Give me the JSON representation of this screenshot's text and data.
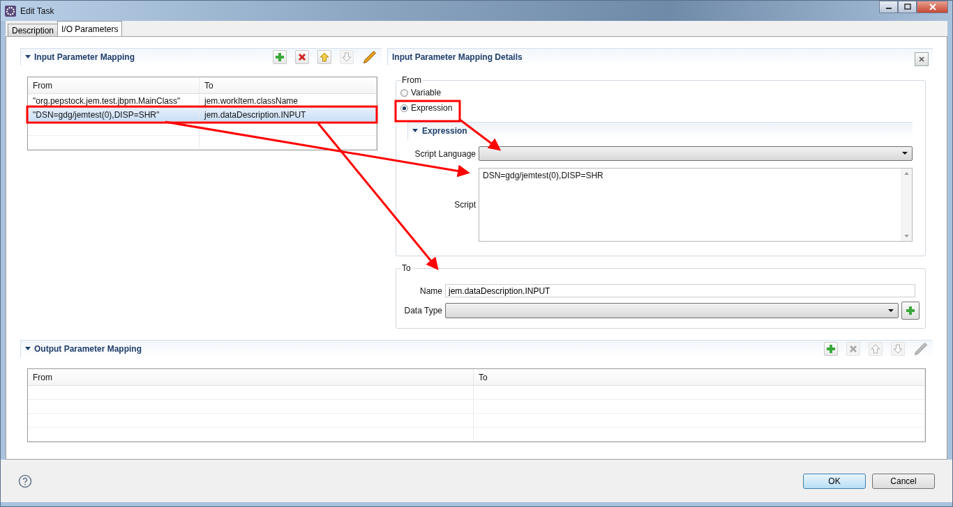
{
  "window": {
    "title": "Edit Task"
  },
  "tabs": [
    {
      "label": "Description",
      "selected": false
    },
    {
      "label": "I/O Parameters",
      "selected": true
    }
  ],
  "input_mapping": {
    "title": "Input Parameter Mapping",
    "toolbar": [
      {
        "kind": "add",
        "disabled": false
      },
      {
        "kind": "delete",
        "disabled": false
      },
      {
        "kind": "up",
        "disabled": false
      },
      {
        "kind": "down",
        "disabled": true
      },
      {
        "kind": "edit",
        "disabled": false
      }
    ],
    "columns": [
      "From",
      "To"
    ],
    "rows": [
      {
        "from": "\"org.pepstock.jem.test.jbpm.MainClass\"",
        "to": "jem.workItem.className",
        "selected": false
      },
      {
        "from": "\"DSN=gdg/jemtest(0),DISP=SHR\"",
        "to": "jem.dataDescription.INPUT",
        "selected": true
      }
    ]
  },
  "details": {
    "title": "Input Parameter Mapping Details",
    "from": {
      "label": "From",
      "options": [
        {
          "label": "Variable",
          "selected": false
        },
        {
          "label": "Expression",
          "selected": true
        }
      ]
    },
    "expression": {
      "title": "Expression",
      "script_language_label": "Script Language",
      "script_label": "Script",
      "script": "DSN=gdg/jemtest(0),DISP=SHR"
    },
    "to": {
      "label": "To",
      "name_label": "Name",
      "name": "jem.dataDescription.INPUT",
      "data_type_label": "Data Type"
    }
  },
  "output_mapping": {
    "title": "Output Parameter Mapping",
    "toolbar": [
      {
        "kind": "add",
        "disabled": false
      },
      {
        "kind": "delete",
        "disabled": true
      },
      {
        "kind": "up",
        "disabled": true
      },
      {
        "kind": "down",
        "disabled": true
      },
      {
        "kind": "edit",
        "disabled": true
      }
    ],
    "columns": [
      "From",
      "To"
    ]
  },
  "buttons": [
    {
      "label": "OK",
      "kind": "default"
    },
    {
      "label": "Cancel",
      "kind": "normal"
    }
  ]
}
